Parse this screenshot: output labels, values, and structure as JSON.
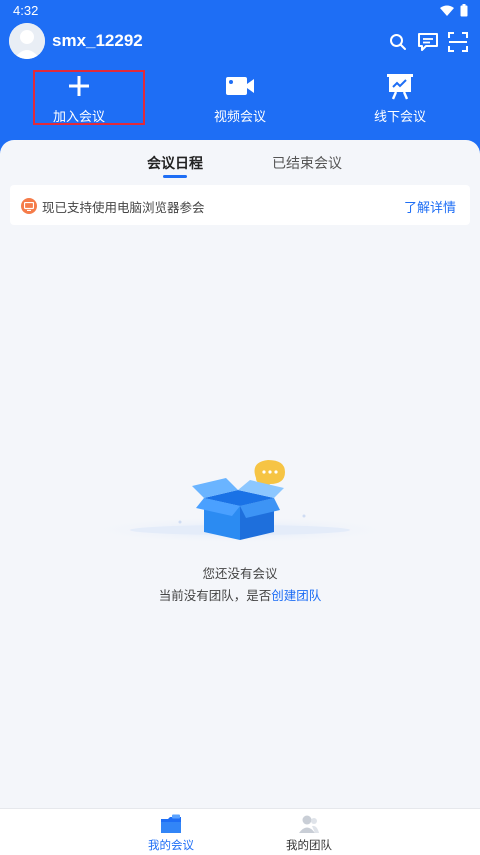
{
  "status_bar": {
    "time": "4:32"
  },
  "profile": {
    "username": "smx_12292"
  },
  "actions": [
    {
      "label": "加入会议",
      "icon": "plus-icon"
    },
    {
      "label": "视频会议",
      "icon": "video-camera-icon"
    },
    {
      "label": "线下会议",
      "icon": "presentation-board-icon"
    }
  ],
  "tabs": [
    {
      "label": "会议日程",
      "active": true
    },
    {
      "label": "已结束会议",
      "active": false
    }
  ],
  "notice": {
    "text": "现已支持使用电脑浏览器参会",
    "link": "了解详情",
    "icon": "monitor-icon"
  },
  "empty_state": {
    "title": "您还没有会议",
    "subtitle_prefix": "当前没有团队，是否",
    "subtitle_link": "创建团队"
  },
  "bottom_nav": [
    {
      "label": "我的会议",
      "active": true,
      "icon": "meeting-folder-icon"
    },
    {
      "label": "我的团队",
      "active": false,
      "icon": "team-person-icon"
    }
  ],
  "colors": {
    "brand": "#1e6ef5",
    "highlight": "#e02a3a",
    "notice_icon": "#f57c4a"
  }
}
